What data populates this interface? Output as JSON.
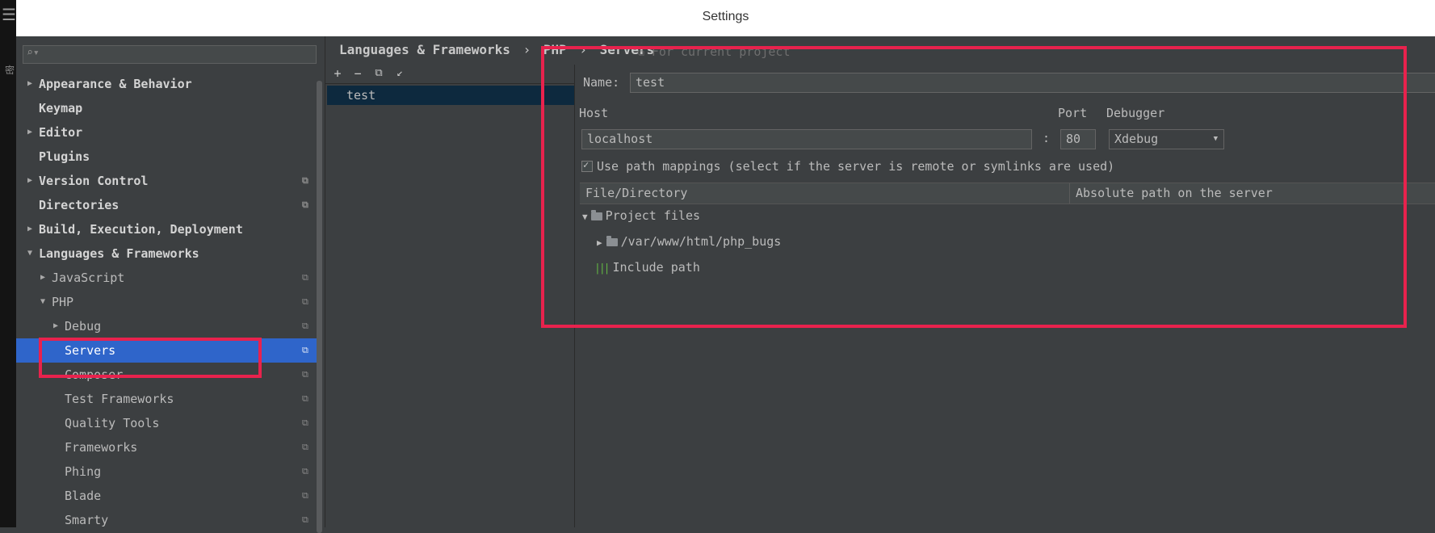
{
  "window": {
    "title": "Settings"
  },
  "colors": {
    "accent": "#2f65ca",
    "highlight": "#e8224d",
    "background": "#3c3f41"
  },
  "left_strip": {
    "menu_icon": "hamburger-icon",
    "glyph": "密"
  },
  "sidebar": {
    "search": {
      "placeholder": "",
      "icon": "search-icon"
    },
    "items": [
      {
        "label": "Appearance & Behavior",
        "expanded": false,
        "bold": true
      },
      {
        "label": "Keymap",
        "bold": true
      },
      {
        "label": "Editor",
        "expanded": false,
        "bold": true
      },
      {
        "label": "Plugins",
        "bold": true
      },
      {
        "label": "Version Control",
        "expanded": false,
        "bold": true,
        "project_scope": true
      },
      {
        "label": "Directories",
        "bold": true,
        "project_scope": true
      },
      {
        "label": "Build, Execution, Deployment",
        "expanded": false,
        "bold": true
      },
      {
        "label": "Languages & Frameworks",
        "expanded": true,
        "bold": true
      },
      {
        "label": "JavaScript",
        "expanded": false,
        "project_scope": true
      },
      {
        "label": "PHP",
        "expanded": true,
        "project_scope": true
      },
      {
        "label": "Debug",
        "expanded": false,
        "project_scope": true
      },
      {
        "label": "Servers",
        "selected": true,
        "project_scope": true
      },
      {
        "label": "Composer",
        "project_scope": true
      },
      {
        "label": "Test Frameworks",
        "project_scope": true
      },
      {
        "label": "Quality Tools",
        "project_scope": true
      },
      {
        "label": "Frameworks",
        "project_scope": true
      },
      {
        "label": "Phing",
        "project_scope": true
      },
      {
        "label": "Blade",
        "project_scope": true
      },
      {
        "label": "Smarty",
        "project_scope": true
      }
    ]
  },
  "breadcrumb": {
    "parts": [
      "Languages & Frameworks",
      "PHP",
      "Servers"
    ],
    "separator": "›",
    "scope_label": "For current project"
  },
  "servers_list": {
    "toolbar": {
      "add": "+",
      "remove": "−",
      "copy": "⧉",
      "import": "↙"
    },
    "items": [
      "test"
    ]
  },
  "server": {
    "name_label": "Name:",
    "name_value": "test",
    "host_label": "Host",
    "host_value": "localhost",
    "colon": ":",
    "port_label": "Port",
    "port_value": "80",
    "debugger_label": "Debugger",
    "debugger_value": "Xdebug",
    "use_path_mappings": true,
    "use_path_mappings_label": "Use path mappings (select if the server is remote or symlinks are used)",
    "mapping_columns": [
      "File/Directory",
      "Absolute path on the server"
    ],
    "mapping_tree": {
      "project_files": "Project files",
      "path": "/var/www/html/php_bugs",
      "include_path": "Include path"
    }
  }
}
